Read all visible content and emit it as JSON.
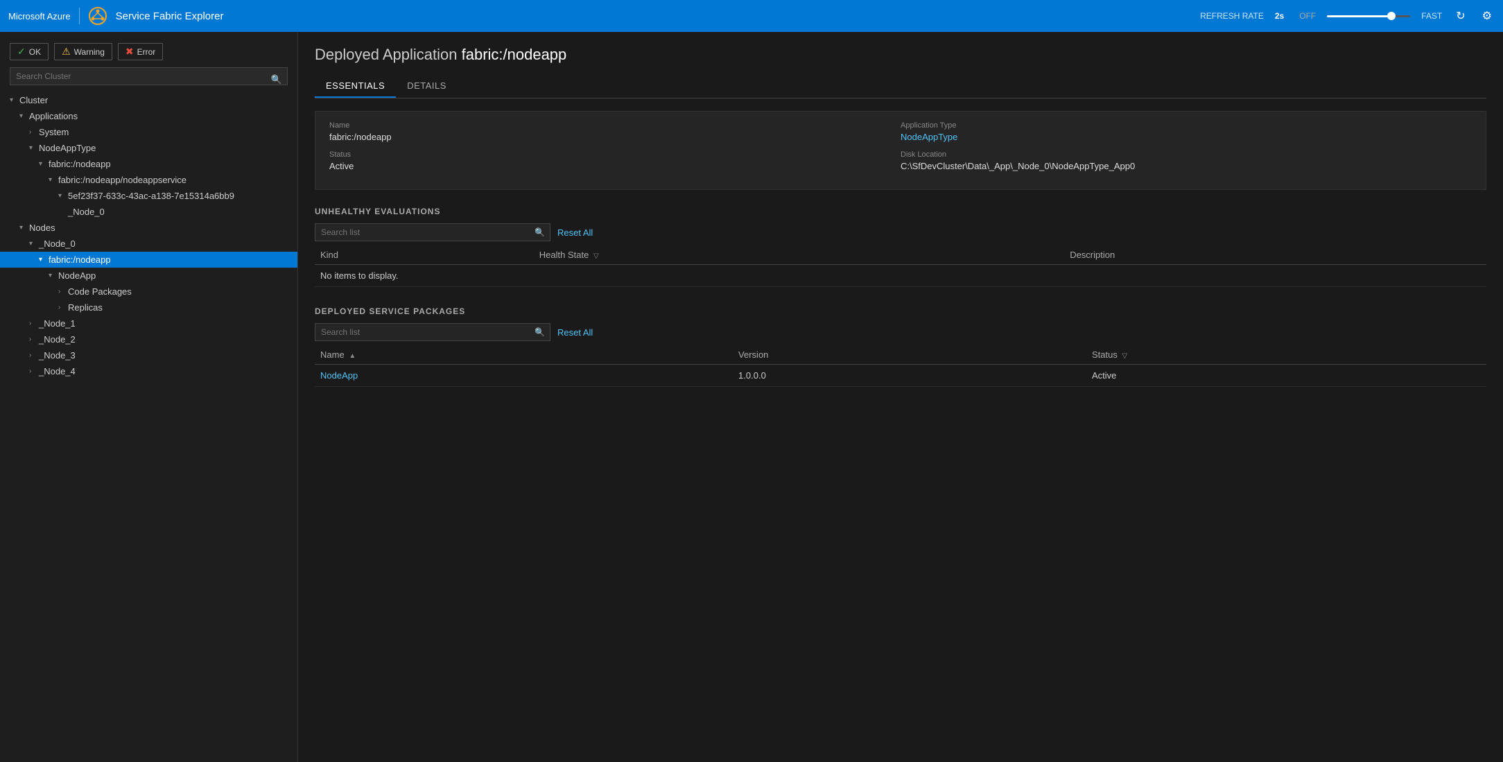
{
  "topbar": {
    "brand": "Microsoft Azure",
    "app_icon_symbol": "⚙",
    "app_title": "Service Fabric Explorer",
    "refresh_label": "REFRESH RATE",
    "refresh_rate": "2s",
    "off_label": "OFF",
    "fast_label": "FAST",
    "slider_value": 80
  },
  "sidebar": {
    "search_placeholder": "Search Cluster",
    "status_buttons": [
      {
        "id": "ok",
        "label": "OK",
        "icon": "✓",
        "icon_class": "ok-icon"
      },
      {
        "id": "warning",
        "label": "Warning",
        "icon": "⚠",
        "icon_class": "warn-icon"
      },
      {
        "id": "error",
        "label": "Error",
        "icon": "✖",
        "icon_class": "err-icon"
      }
    ],
    "tree": [
      {
        "label": "Cluster",
        "indent": "indent-1",
        "chevron": "▾",
        "expanded": true
      },
      {
        "label": "Applications",
        "indent": "indent-2",
        "chevron": "▾",
        "expanded": true
      },
      {
        "label": "System",
        "indent": "indent-3",
        "chevron": "›",
        "expanded": false
      },
      {
        "label": "NodeAppType",
        "indent": "indent-3",
        "chevron": "▾",
        "expanded": true
      },
      {
        "label": "fabric:/nodeapp",
        "indent": "indent-4",
        "chevron": "▾",
        "expanded": true
      },
      {
        "label": "fabric:/nodeapp/nodeappservice",
        "indent": "indent-5",
        "chevron": "▾",
        "expanded": true
      },
      {
        "label": "5ef23f37-633c-43ac-a138-7e15314a6bb9",
        "indent": "indent-6",
        "chevron": "▾",
        "expanded": true
      },
      {
        "label": "_Node_0",
        "indent": "indent-6",
        "chevron": "",
        "expanded": false
      },
      {
        "label": "Nodes",
        "indent": "indent-2",
        "chevron": "▾",
        "expanded": true
      },
      {
        "label": "_Node_0",
        "indent": "indent-3",
        "chevron": "▾",
        "expanded": true,
        "selected": false
      },
      {
        "label": "fabric:/nodeapp",
        "indent": "indent-4",
        "chevron": "▾",
        "expanded": true,
        "selected": true
      },
      {
        "label": "NodeApp",
        "indent": "indent-5",
        "chevron": "▾",
        "expanded": true
      },
      {
        "label": "Code Packages",
        "indent": "indent-6",
        "chevron": "›",
        "expanded": false
      },
      {
        "label": "Replicas",
        "indent": "indent-6",
        "chevron": "›",
        "expanded": false
      },
      {
        "label": "_Node_1",
        "indent": "indent-3",
        "chevron": "›",
        "expanded": false
      },
      {
        "label": "_Node_2",
        "indent": "indent-3",
        "chevron": "›",
        "expanded": false
      },
      {
        "label": "_Node_3",
        "indent": "indent-3",
        "chevron": "›",
        "expanded": false
      },
      {
        "label": "_Node_4",
        "indent": "indent-3",
        "chevron": "›",
        "expanded": false
      }
    ]
  },
  "content": {
    "title_prefix": "Deployed Application",
    "title_app": "fabric:/nodeapp",
    "tabs": [
      {
        "id": "essentials",
        "label": "ESSENTIALS",
        "active": true
      },
      {
        "id": "details",
        "label": "DETAILS",
        "active": false
      }
    ],
    "essentials": {
      "name_label": "Name",
      "name_value": "fabric:/nodeapp",
      "app_type_label": "Application Type",
      "app_type_value": "NodeAppType",
      "status_label": "Status",
      "status_value": "Active",
      "disk_location_label": "Disk Location",
      "disk_location_value": "C:\\SfDevCluster\\Data\\_App\\_Node_0\\NodeAppType_App0"
    },
    "unhealthy_evaluations": {
      "section_label": "UNHEALTHY EVALUATIONS",
      "search_placeholder": "Search list",
      "reset_all_label": "Reset All",
      "columns": [
        {
          "label": "Kind",
          "has_filter": false,
          "has_sort": false
        },
        {
          "label": "Health State",
          "has_filter": true,
          "has_sort": false
        },
        {
          "label": "Description",
          "has_filter": false,
          "has_sort": false
        }
      ],
      "no_items_text": "No items to display.",
      "rows": []
    },
    "deployed_service_packages": {
      "section_label": "DEPLOYED SERVICE PACKAGES",
      "search_placeholder": "Search list",
      "reset_all_label": "Reset All",
      "columns": [
        {
          "label": "Name",
          "has_filter": false,
          "has_sort": true
        },
        {
          "label": "Version",
          "has_filter": false,
          "has_sort": false
        },
        {
          "label": "Status",
          "has_filter": true,
          "has_sort": false
        }
      ],
      "rows": [
        {
          "name": "NodeApp",
          "version": "1.0.0.0",
          "status": "Active"
        }
      ]
    }
  }
}
